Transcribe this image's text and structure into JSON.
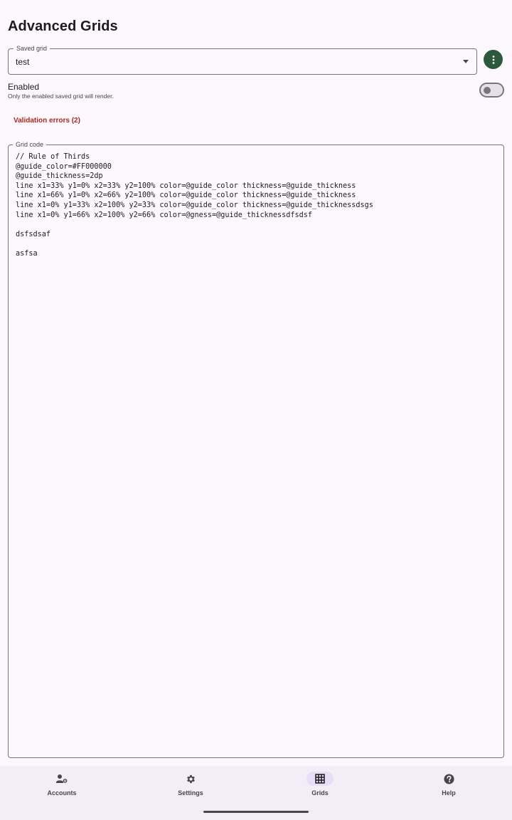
{
  "header": {
    "title": "Advanced Grids"
  },
  "saved_grid": {
    "label": "Saved grid",
    "value": "test"
  },
  "enabled": {
    "title": "Enabled",
    "subtitle": "Only the enabled saved grid will render.",
    "state": "off"
  },
  "validation": {
    "label": "Validation errors (2)"
  },
  "grid_code": {
    "label": "Grid code",
    "value": "// Rule of Thirds\n@guide_color=#FF000000\n@guide_thickness=2dp\nline x1=33% y1=0% x2=33% y2=100% color=@guide_color thickness=@guide_thickness\nline x1=66% y1=0% x2=66% y2=100% color=@guide_color thickness=@guide_thickness\nline x1=0% y1=33% x2=100% y2=33% color=@guide_color thickness=@guide_thicknessdsgs\nline x1=0% y1=66% x2=100% y2=66% color=@gness=@guide_thicknessdfsdsf\n\ndsfsdsaf\n\nasfsa"
  },
  "nav": {
    "items": [
      {
        "label": "Accounts",
        "icon": "accounts-icon"
      },
      {
        "label": "Settings",
        "icon": "gear-icon"
      },
      {
        "label": "Grids",
        "icon": "grid-icon",
        "active": true
      },
      {
        "label": "Help",
        "icon": "help-icon"
      }
    ]
  },
  "colors": {
    "accent": "#2a5a3b",
    "error": "#b3261e",
    "background": "#fdf8fd",
    "nav_background": "#f3edf7",
    "nav_active_pill": "#e8def8"
  }
}
